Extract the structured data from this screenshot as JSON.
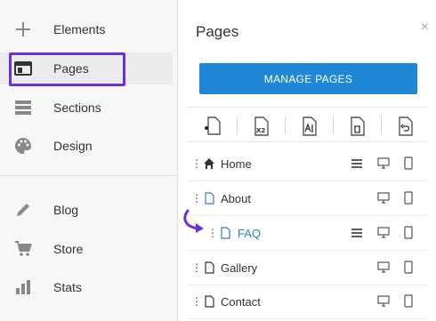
{
  "sidebar": {
    "items": [
      {
        "label": "Elements",
        "icon": "plus-icon"
      },
      {
        "label": "Pages",
        "icon": "pages-icon"
      },
      {
        "label": "Sections",
        "icon": "sections-icon"
      },
      {
        "label": "Design",
        "icon": "palette-icon"
      },
      {
        "label": "Blog",
        "icon": "pencil-icon"
      },
      {
        "label": "Store",
        "icon": "cart-icon"
      },
      {
        "label": "Stats",
        "icon": "bar-chart-icon"
      }
    ],
    "active_item": "Pages",
    "highlight_color": "#6b2ee0"
  },
  "panel": {
    "title": "Pages",
    "close_symbol": "×",
    "manage_button": "MANAGE PAGES",
    "button_color": "#1e88d6",
    "toolbar": [
      "add-page-icon",
      "duplicate-page-icon",
      "rename-page-icon",
      "delete-page-icon",
      "undo-icon"
    ],
    "duplicate_badge": "X2",
    "pages": [
      {
        "label": "Home",
        "icon": "home-icon",
        "has_menu": true
      },
      {
        "label": "About",
        "icon": "page-icon",
        "has_menu": false
      },
      {
        "label": "FAQ",
        "icon": "page-icon",
        "has_menu": true,
        "selected": true
      },
      {
        "label": "Gallery",
        "icon": "page-icon",
        "has_menu": false
      },
      {
        "label": "Contact",
        "icon": "page-icon",
        "has_menu": false
      }
    ]
  }
}
